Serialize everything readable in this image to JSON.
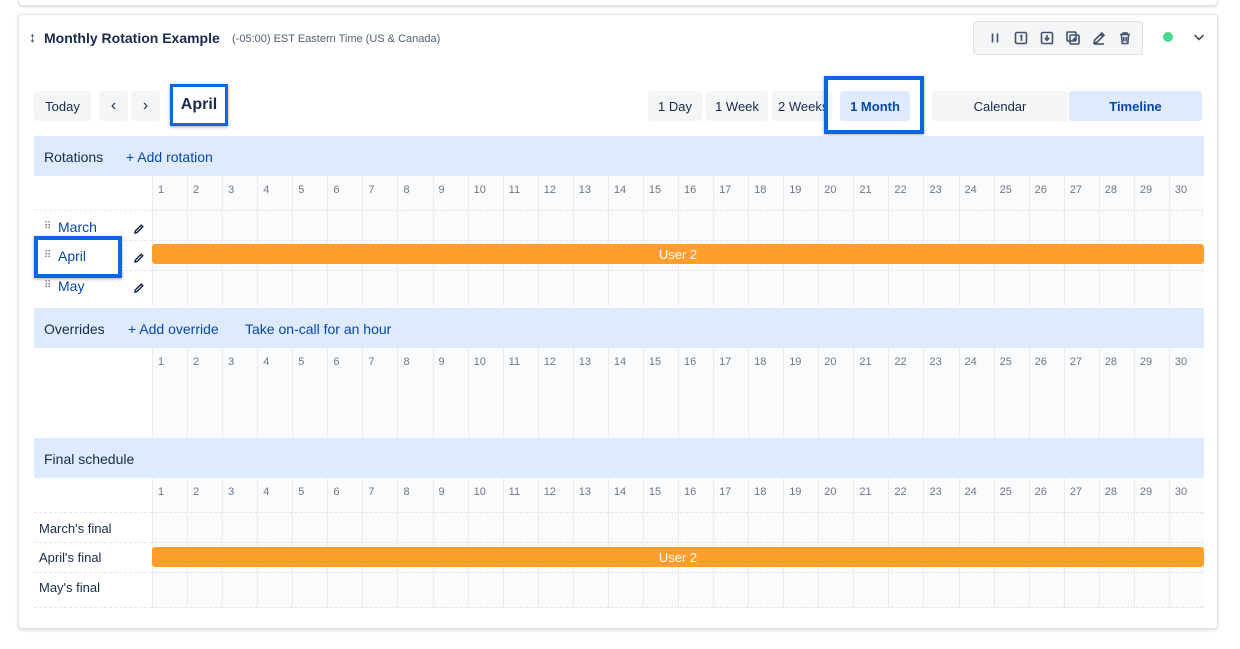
{
  "schedule": {
    "title": "Monthly Rotation Example",
    "timezone": "(-05:00) EST Eastern Time (US & Canada)",
    "status_color": "#4ad68b"
  },
  "actions": [
    {
      "name": "pause-icon"
    },
    {
      "name": "calendar-one-icon"
    },
    {
      "name": "import-icon"
    },
    {
      "name": "duplicate-icon"
    },
    {
      "name": "edit-icon"
    },
    {
      "name": "delete-icon"
    }
  ],
  "toolbar": {
    "today_label": "Today",
    "prev_label": "‹",
    "next_label": "›",
    "current_month": "April",
    "ranges": [
      "1 Day",
      "1 Week",
      "2 Weeks",
      "1 Month"
    ],
    "selected_range": "1 Month",
    "views": [
      "Calendar",
      "Timeline"
    ],
    "selected_view": "Timeline"
  },
  "days": [
    "1",
    "2",
    "3",
    "4",
    "5",
    "6",
    "7",
    "8",
    "9",
    "10",
    "11",
    "12",
    "13",
    "14",
    "15",
    "16",
    "17",
    "18",
    "19",
    "20",
    "21",
    "22",
    "23",
    "24",
    "25",
    "26",
    "27",
    "28",
    "29",
    "30"
  ],
  "rotations": {
    "label": "Rotations",
    "add_label": "+ Add rotation",
    "items": [
      {
        "name": "March"
      },
      {
        "name": "April",
        "bar": "User 2"
      },
      {
        "name": "May"
      }
    ]
  },
  "overrides": {
    "label": "Overrides",
    "add_label": "+ Add override",
    "take_oncall_label": "Take on-call for an hour"
  },
  "final": {
    "label": "Final schedule",
    "rows": [
      {
        "name": "March's final"
      },
      {
        "name": "April's final",
        "bar": "User 2"
      },
      {
        "name": "May's final"
      }
    ]
  },
  "colors": {
    "accent": "#0747a6",
    "bar": "#ff9e2c",
    "section_bg": "#deebff",
    "highlight": "#0c66e4"
  }
}
